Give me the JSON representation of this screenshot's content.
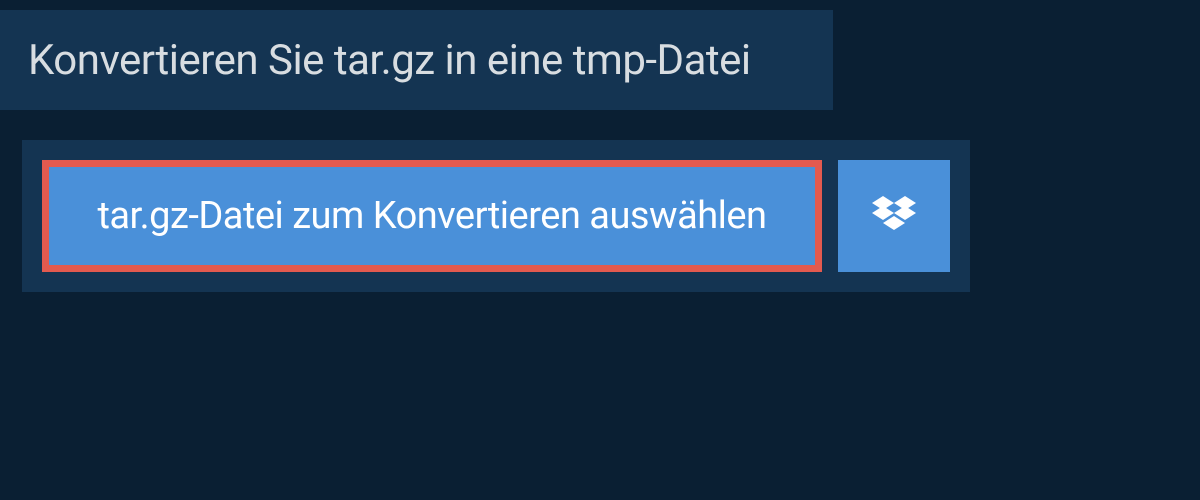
{
  "header": {
    "title": "Konvertieren Sie tar.gz in eine tmp-Datei"
  },
  "actions": {
    "select_file_label": "tar.gz-Datei zum Konvertieren auswählen"
  },
  "colors": {
    "page_bg": "#0a1f33",
    "panel_bg": "#143452",
    "button_bg": "#4a90d9",
    "highlight_border": "#e35a4f",
    "text_light": "#d8dde1",
    "text_white": "#ffffff"
  }
}
